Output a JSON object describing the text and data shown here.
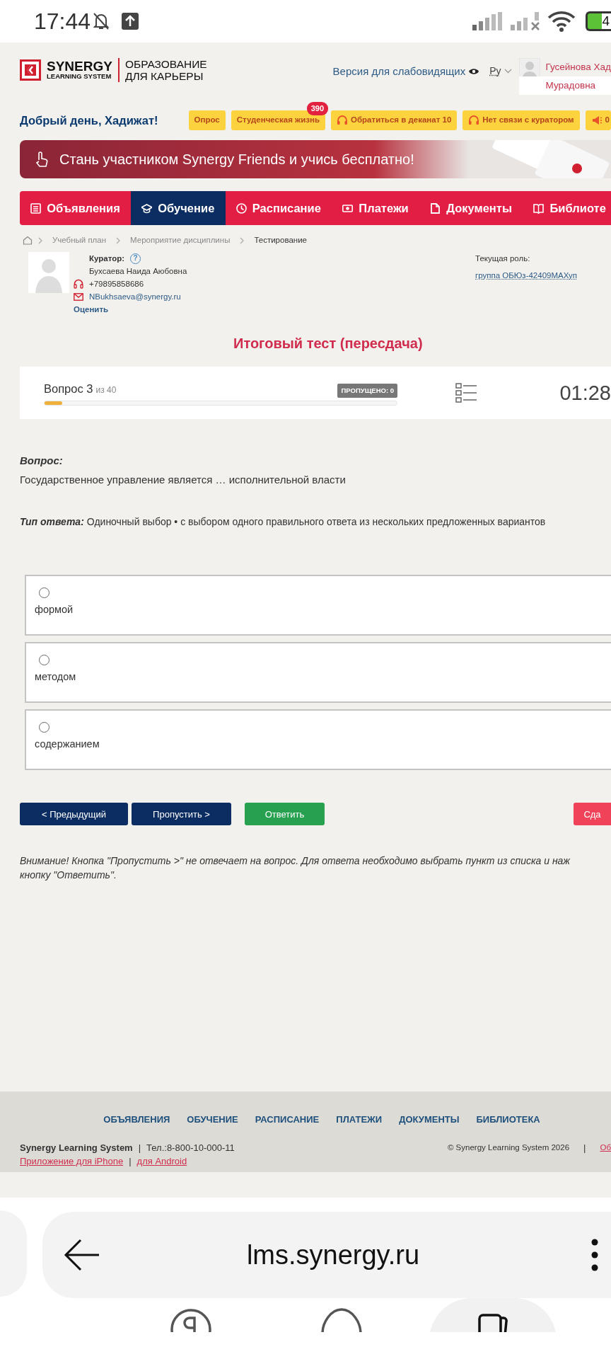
{
  "status_bar": {
    "time": "17:44",
    "battery": "4"
  },
  "header": {
    "logo_brand": "SYNERGY",
    "logo_sub": "LEARNING SYSTEM",
    "logo_tagline_1": "ОБРАЗОВАНИЕ",
    "logo_tagline_2": "ДЛЯ КАРЬЕРЫ",
    "accessibility_link": "Версия для слабовидящих",
    "language": "Ру",
    "user_name_1": "Гусейнова Хад",
    "user_name_2": "Мурадовна"
  },
  "greeting": "Добрый день, Хадижат!",
  "quick_links": [
    {
      "label": "Опрос"
    },
    {
      "label": "Студенческая жизнь",
      "badge": "390"
    },
    {
      "label": "Обратиться в деканат 10"
    },
    {
      "label": "Нет связи с куратором"
    },
    {
      "label": "0"
    }
  ],
  "banner": {
    "text": "Стань участником Synergy Friends и учись бесплатно!"
  },
  "nav": [
    {
      "label": "Объявления",
      "selected": false
    },
    {
      "label": "Обучение",
      "selected": true
    },
    {
      "label": "Расписание",
      "selected": false
    },
    {
      "label": "Платежи",
      "selected": false
    },
    {
      "label": "Документы",
      "selected": false
    },
    {
      "label": "Библиоте",
      "selected": false
    }
  ],
  "breadcrumb": [
    "Учебный план",
    "Мероприятие дисциплины",
    "Тестирование"
  ],
  "curator": {
    "label": "Куратор:",
    "help": "?",
    "name": "Бухсаева Наида Аюбовна",
    "phone": "+79895858686",
    "email": "NBukhsaeva@synergy.ru",
    "rate_link": "Оценить"
  },
  "role": {
    "label": "Текущая роль:",
    "value": "группа ОБЮз-42409МАХуп"
  },
  "test": {
    "title": "Итоговый тест (пересдача)",
    "question_label": "Вопрос 3",
    "question_total": "из 40",
    "skipped": "ПРОПУЩЕНО: 0",
    "progress": {
      "level": 0.05
    },
    "timer": "01:28"
  },
  "question": {
    "label": "Вопрос:",
    "text": "Государственное управление является … исполнительной власти",
    "type_label": "Тип ответа:",
    "type_text": "Одиночный выбор • с выбором одного правильного ответа из нескольких предложенных вариантов"
  },
  "options": [
    {
      "label": "формой",
      "selected": false
    },
    {
      "label": "методом",
      "selected": false
    },
    {
      "label": "содержанием",
      "selected": false
    }
  ],
  "buttons": [
    {
      "label": "< Предыдущий",
      "kind": "navy"
    },
    {
      "label": "Пропустить >",
      "kind": "navy"
    },
    {
      "label": "Ответить",
      "kind": "green"
    },
    {
      "label": "Сда",
      "kind": "red"
    }
  ],
  "warning_lines": [
    "Внимание! Кнопка \"Пропустить >\" не отвечает на вопрос. Для ответа необходимо выбрать пункт из списка и наж",
    "кнопку \"Ответить\"."
  ],
  "footer": {
    "links": [
      "ОБЪЯВЛЕНИЯ",
      "ОБУЧЕНИЕ",
      "РАСПИСАНИЕ",
      "ПЛАТЕЖИ",
      "ДОКУМЕНТЫ",
      "БИБЛИОТЕКА"
    ],
    "brand": "Synergy Learning System",
    "separator_1": "|",
    "phone": "Тел.:8-800-10-000-11",
    "copyright": "© Synergy Learning System 2026",
    "separator_2": "|",
    "cut_link": "Об",
    "app_iphone": "Приложение для iPhone",
    "separator_3": "|",
    "app_android": "для Android"
  },
  "browser": {
    "url": "lms.synergy.ru"
  }
}
